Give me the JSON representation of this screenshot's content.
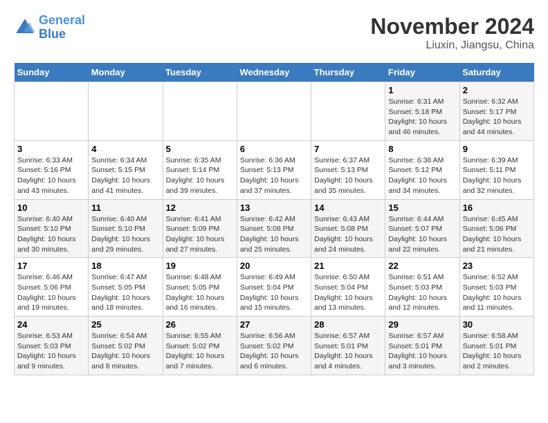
{
  "header": {
    "logo_line1": "General",
    "logo_line2": "Blue",
    "month": "November 2024",
    "location": "Liuxin, Jiangsu, China"
  },
  "weekdays": [
    "Sunday",
    "Monday",
    "Tuesday",
    "Wednesday",
    "Thursday",
    "Friday",
    "Saturday"
  ],
  "weeks": [
    [
      {
        "day": "",
        "info": ""
      },
      {
        "day": "",
        "info": ""
      },
      {
        "day": "",
        "info": ""
      },
      {
        "day": "",
        "info": ""
      },
      {
        "day": "",
        "info": ""
      },
      {
        "day": "1",
        "info": "Sunrise: 6:31 AM\nSunset: 5:18 PM\nDaylight: 10 hours and 46 minutes."
      },
      {
        "day": "2",
        "info": "Sunrise: 6:32 AM\nSunset: 5:17 PM\nDaylight: 10 hours and 44 minutes."
      }
    ],
    [
      {
        "day": "3",
        "info": "Sunrise: 6:33 AM\nSunset: 5:16 PM\nDaylight: 10 hours and 43 minutes."
      },
      {
        "day": "4",
        "info": "Sunrise: 6:34 AM\nSunset: 5:15 PM\nDaylight: 10 hours and 41 minutes."
      },
      {
        "day": "5",
        "info": "Sunrise: 6:35 AM\nSunset: 5:14 PM\nDaylight: 10 hours and 39 minutes."
      },
      {
        "day": "6",
        "info": "Sunrise: 6:36 AM\nSunset: 5:13 PM\nDaylight: 10 hours and 37 minutes."
      },
      {
        "day": "7",
        "info": "Sunrise: 6:37 AM\nSunset: 5:13 PM\nDaylight: 10 hours and 35 minutes."
      },
      {
        "day": "8",
        "info": "Sunrise: 6:38 AM\nSunset: 5:12 PM\nDaylight: 10 hours and 34 minutes."
      },
      {
        "day": "9",
        "info": "Sunrise: 6:39 AM\nSunset: 5:11 PM\nDaylight: 10 hours and 32 minutes."
      }
    ],
    [
      {
        "day": "10",
        "info": "Sunrise: 6:40 AM\nSunset: 5:10 PM\nDaylight: 10 hours and 30 minutes."
      },
      {
        "day": "11",
        "info": "Sunrise: 6:40 AM\nSunset: 5:10 PM\nDaylight: 10 hours and 29 minutes."
      },
      {
        "day": "12",
        "info": "Sunrise: 6:41 AM\nSunset: 5:09 PM\nDaylight: 10 hours and 27 minutes."
      },
      {
        "day": "13",
        "info": "Sunrise: 6:42 AM\nSunset: 5:08 PM\nDaylight: 10 hours and 25 minutes."
      },
      {
        "day": "14",
        "info": "Sunrise: 6:43 AM\nSunset: 5:08 PM\nDaylight: 10 hours and 24 minutes."
      },
      {
        "day": "15",
        "info": "Sunrise: 6:44 AM\nSunset: 5:07 PM\nDaylight: 10 hours and 22 minutes."
      },
      {
        "day": "16",
        "info": "Sunrise: 6:45 AM\nSunset: 5:06 PM\nDaylight: 10 hours and 21 minutes."
      }
    ],
    [
      {
        "day": "17",
        "info": "Sunrise: 6:46 AM\nSunset: 5:06 PM\nDaylight: 10 hours and 19 minutes."
      },
      {
        "day": "18",
        "info": "Sunrise: 6:47 AM\nSunset: 5:05 PM\nDaylight: 10 hours and 18 minutes."
      },
      {
        "day": "19",
        "info": "Sunrise: 6:48 AM\nSunset: 5:05 PM\nDaylight: 10 hours and 16 minutes."
      },
      {
        "day": "20",
        "info": "Sunrise: 6:49 AM\nSunset: 5:04 PM\nDaylight: 10 hours and 15 minutes."
      },
      {
        "day": "21",
        "info": "Sunrise: 6:50 AM\nSunset: 5:04 PM\nDaylight: 10 hours and 13 minutes."
      },
      {
        "day": "22",
        "info": "Sunrise: 6:51 AM\nSunset: 5:03 PM\nDaylight: 10 hours and 12 minutes."
      },
      {
        "day": "23",
        "info": "Sunrise: 6:52 AM\nSunset: 5:03 PM\nDaylight: 10 hours and 11 minutes."
      }
    ],
    [
      {
        "day": "24",
        "info": "Sunrise: 6:53 AM\nSunset: 5:03 PM\nDaylight: 10 hours and 9 minutes."
      },
      {
        "day": "25",
        "info": "Sunrise: 6:54 AM\nSunset: 5:02 PM\nDaylight: 10 hours and 8 minutes."
      },
      {
        "day": "26",
        "info": "Sunrise: 6:55 AM\nSunset: 5:02 PM\nDaylight: 10 hours and 7 minutes."
      },
      {
        "day": "27",
        "info": "Sunrise: 6:56 AM\nSunset: 5:02 PM\nDaylight: 10 hours and 6 minutes."
      },
      {
        "day": "28",
        "info": "Sunrise: 6:57 AM\nSunset: 5:01 PM\nDaylight: 10 hours and 4 minutes."
      },
      {
        "day": "29",
        "info": "Sunrise: 6:57 AM\nSunset: 5:01 PM\nDaylight: 10 hours and 3 minutes."
      },
      {
        "day": "30",
        "info": "Sunrise: 6:58 AM\nSunset: 5:01 PM\nDaylight: 10 hours and 2 minutes."
      }
    ]
  ]
}
